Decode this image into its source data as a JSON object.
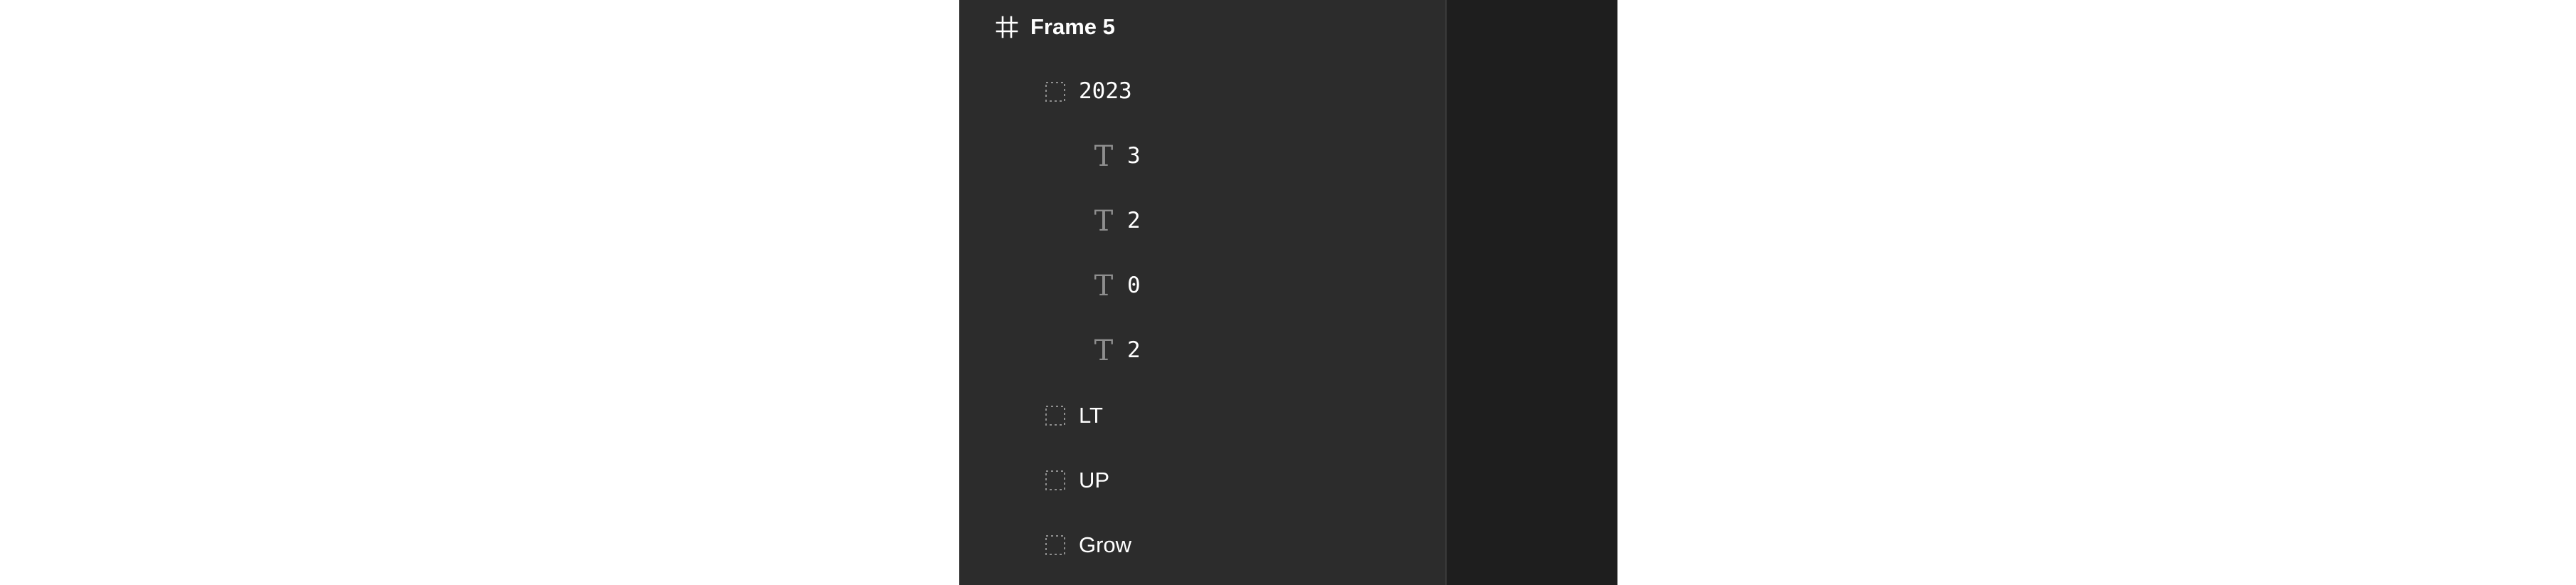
{
  "layers": [
    {
      "label": "Frame 5",
      "icon": "frame-icon",
      "depth": 0
    },
    {
      "label": "2023",
      "icon": "group-icon",
      "depth": 1
    },
    {
      "label": "3",
      "icon": "text-icon",
      "depth": 2
    },
    {
      "label": "2",
      "icon": "text-icon",
      "depth": 2
    },
    {
      "label": "0",
      "icon": "text-icon",
      "depth": 2
    },
    {
      "label": "2",
      "icon": "text-icon",
      "depth": 2
    },
    {
      "label": "LT",
      "icon": "group-icon",
      "depth": 1
    },
    {
      "label": "UP",
      "icon": "group-icon",
      "depth": 1
    },
    {
      "label": "Grow",
      "icon": "group-icon",
      "depth": 1
    }
  ],
  "icons": {
    "text_glyph": "T"
  },
  "colors": {
    "panel_bg": "#2c2c2c",
    "canvas_bg": "#1e1e1e",
    "text": "#ffffff",
    "icon_muted": "#8e8e8e"
  }
}
